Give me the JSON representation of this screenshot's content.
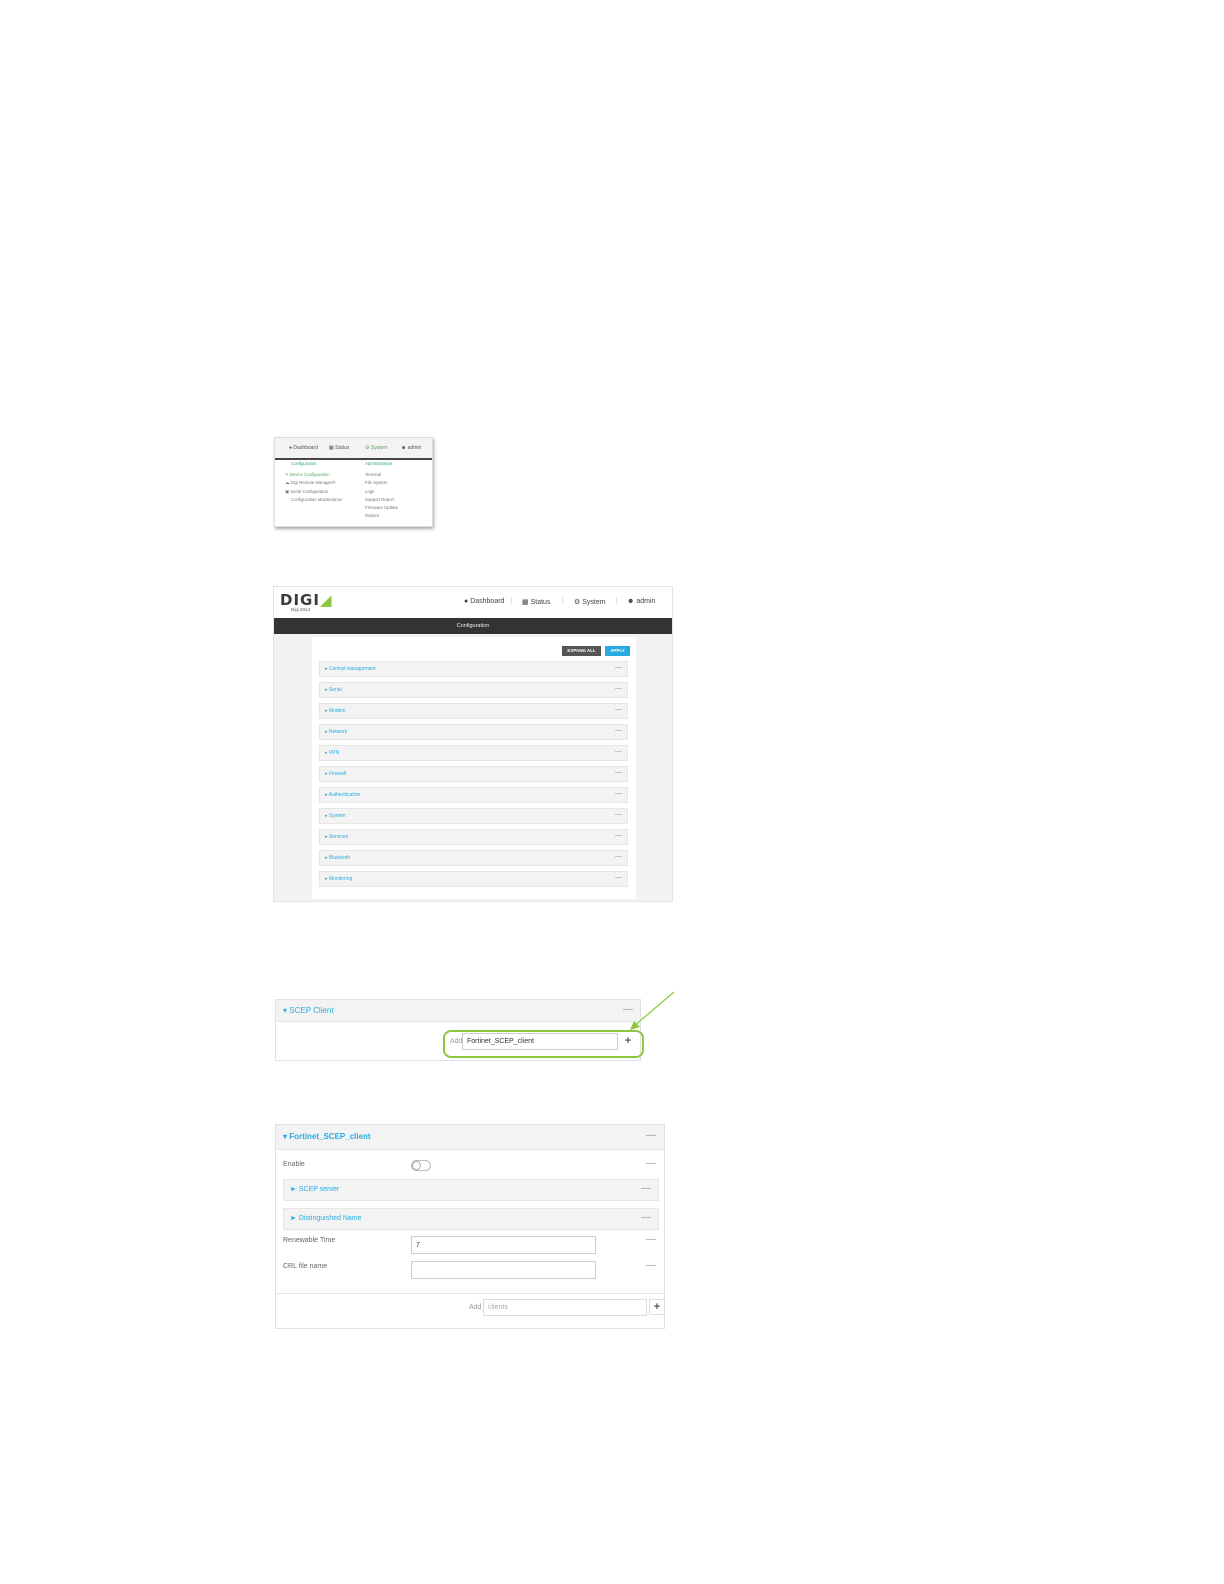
{
  "fig1": {
    "nav": [
      "Dashboard",
      "Status",
      "System",
      "admin"
    ],
    "left_header": "Configuration",
    "left_items": [
      "Device Configuration",
      "Digi Remote Manager®",
      "Serial Configuration",
      "Configuration Maintenance"
    ],
    "right_header": "Administration",
    "right_items": [
      "Terminal",
      "File System",
      "Logs",
      "Support Report",
      "Firmware Update",
      "Reboot"
    ]
  },
  "fig2": {
    "logo": "DIGI",
    "logo_sub": "Digi 2014",
    "nav": [
      "Dashboard",
      "Status",
      "System",
      "admin"
    ],
    "bar_title": "Configuration",
    "expand_all": "EXPAND ALL",
    "apply": "APPLY",
    "sections": [
      "Central management",
      "Serial",
      "Modem",
      "Network",
      "VPN",
      "Firewall",
      "Authentication",
      "System",
      "Services",
      "Bluetooth",
      "Monitoring"
    ]
  },
  "fig3": {
    "title": "▾ SCEP Client",
    "add_label": "Add",
    "input_value": "Fortinet_SCEP_client",
    "plus": "+",
    "minus": "—"
  },
  "fig4": {
    "title": "▾ Fortinet_SCEP_client",
    "enable_label": "Enable",
    "scep_server": "► SCEP server",
    "distinguished_name": "► Distinguished Name",
    "renewable_time_label": "Renewable Time",
    "renewable_time_value": "7",
    "crl_label": "CRL file name",
    "crl_value": "",
    "add_label": "Add",
    "add_placeholder": "clients",
    "plus": "+",
    "minus": "—"
  },
  "colors": {
    "accent": "#29abe2",
    "highlight": "#8dc63f",
    "dark_bar": "#333333"
  }
}
